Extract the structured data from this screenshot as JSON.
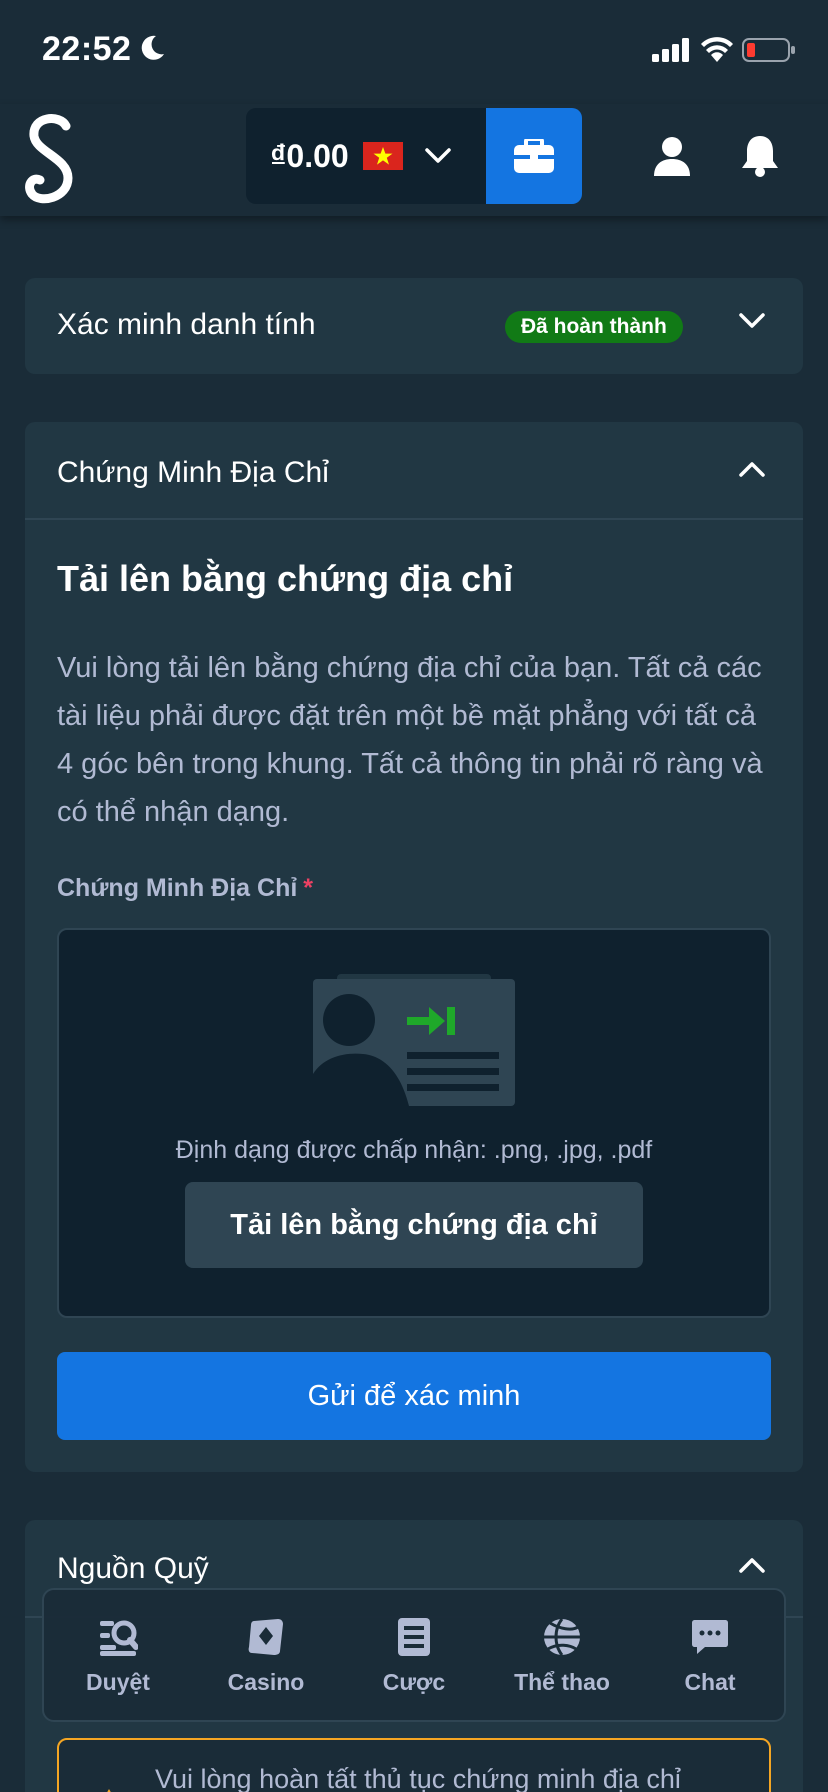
{
  "status_bar": {
    "time": "22:52"
  },
  "header": {
    "logo_icon": "stake-s-logo",
    "balance": "₫0.00",
    "currency_flag": "vietnam-flag-icon",
    "wallet_icon": "wallet-icon",
    "profile_icon": "user-icon",
    "notifications_icon": "bell-icon"
  },
  "identity_card": {
    "title": "Xác minh danh tính",
    "status_badge": "Đã hoàn thành"
  },
  "address_card": {
    "title": "Chứng Minh Địa Chỉ",
    "heading": "Tải lên bằng chứng địa chỉ",
    "description": "Vui lòng tải lên bằng chứng địa chỉ của bạn. Tất cả các tài liệu phải được đặt trên một bề mặt phẳng với tất cả 4 góc bên trong khung. Tất cả thông tin phải rõ ràng và có thể nhận dạng.",
    "field_label": "Chứng Minh Địa Chỉ",
    "required_mark": "*",
    "formats": "Định dạng được chấp nhận: .png, .jpg, .pdf",
    "upload_button": "Tải lên bằng chứng địa chỉ",
    "submit_button": "Gửi để xác minh"
  },
  "funds_card": {
    "title": "Nguồn Quỹ",
    "warning": "Vui lòng hoàn tất thủ tục chứng minh địa chỉ"
  },
  "bottom_nav": {
    "items": [
      {
        "label": "Duyệt",
        "icon": "browse-icon"
      },
      {
        "label": "Casino",
        "icon": "casino-cards-icon"
      },
      {
        "label": "Cược",
        "icon": "bet-slip-icon"
      },
      {
        "label": "Thể thao",
        "icon": "basketball-icon"
      },
      {
        "label": "Chat",
        "icon": "chat-icon"
      }
    ]
  },
  "colors": {
    "background": "#1a2c38",
    "card": "#213743",
    "primary": "#1475e1",
    "success": "#117a16",
    "muted_text": "#b1bad3",
    "warning": "#f5a623"
  }
}
